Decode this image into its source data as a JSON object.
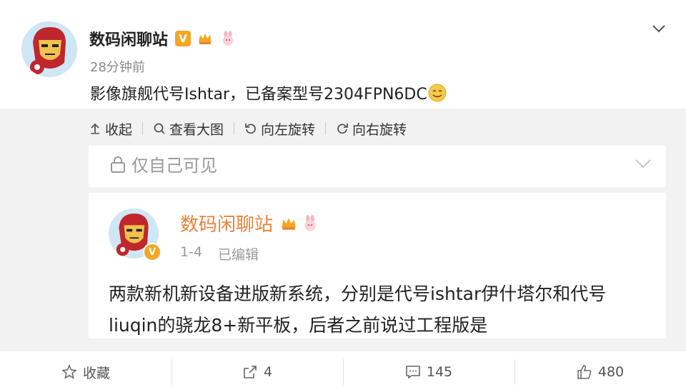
{
  "post": {
    "author": "数码闲聊站",
    "time": "28分钟前",
    "text": "影像旗舰代号Ishtar，已备案型号2304FPN6DC",
    "badges": [
      "verified-v-icon",
      "crown-icon",
      "bunny-icon"
    ]
  },
  "toolbar": {
    "collapse": "收起",
    "view_large": "查看大图",
    "rotate_left": "向左旋转",
    "rotate_right": "向右旋转"
  },
  "card": {
    "visibility": "仅自己可见",
    "author": "数码闲聊站",
    "date": "1-4",
    "edited": "已编辑",
    "body": "两款新机新设备进版新系统，分别是代号ishtar伊什塔尔和代号liuqin的骁龙8+新平板，后者之前说过工程版是"
  },
  "actions": {
    "favorite": "收藏",
    "repost_count": "4",
    "comment_count": "145",
    "like_count": "480"
  },
  "colors": {
    "accent_orange": "#e8823a",
    "badge_gold": "#f5a623",
    "background_gray": "#f2f2f2"
  }
}
